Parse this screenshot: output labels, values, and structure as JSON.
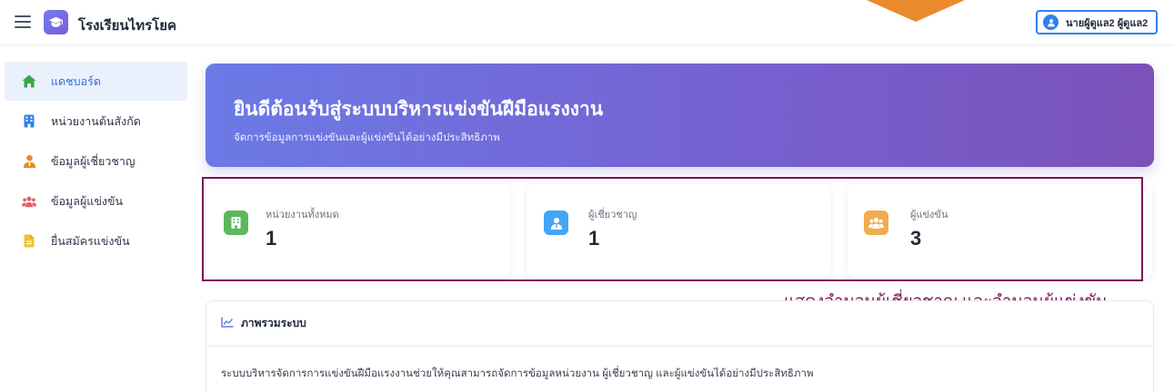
{
  "app": {
    "brand_name": "โรงเรียนไทรโยค",
    "brand_icon": "graduation-cap-icon"
  },
  "user": {
    "name": "นายผู้ดูแล2 ผู้ดูแล2",
    "icon": "user-icon"
  },
  "sidebar": {
    "items": [
      {
        "label": "แดชบอร์ด",
        "icon": "home-icon",
        "active": true,
        "color": "#3aa64a"
      },
      {
        "label": "หน่วยงานต้นสังกัด",
        "icon": "building-icon",
        "active": false,
        "color": "#2f80ed"
      },
      {
        "label": "ข้อมูลผู้เชี่ยวชาญ",
        "icon": "user-tie-icon",
        "active": false,
        "color": "#e98a2c"
      },
      {
        "label": "ข้อมูลผู้แข่งขัน",
        "icon": "users-icon",
        "active": false,
        "color": "#e85d6c"
      },
      {
        "label": "ยื่นสมัครแข่งขัน",
        "icon": "file-icon",
        "active": false,
        "color": "#f2c22e"
      }
    ]
  },
  "hero": {
    "title": "ยินดีต้อนรับสู่ระบบบริหารแข่งขันฝีมือแรงงาน",
    "subtitle": "จัดการข้อมูลการแข่งขันและผู้แข่งขันได้อย่างมีประสิทธิภาพ"
  },
  "stats": [
    {
      "label": "หน่วยงานทั้งหมด",
      "value": "1",
      "icon": "building-icon",
      "color": "#5cb85c"
    },
    {
      "label": "ผู้เชี่ยวชาญ",
      "value": "1",
      "icon": "user-tie-icon",
      "color": "#42a5f5"
    },
    {
      "label": "ผู้แข่งขัน",
      "value": "3",
      "icon": "users-icon",
      "color": "#f0ad4e"
    }
  ],
  "annotation": "แสดงจำนวนผู้เชี่ยวชาญ และจำนวนผู้แข่งขัน",
  "overview": {
    "title": "ภาพรวมระบบ",
    "icon": "chart-line-icon",
    "body": "ระบบบริหารจัดการการแข่งขันฝีมือแรงงานช่วยให้คุณสามารถจัดการข้อมูลหน่วยงาน ผู้เชี่ยวชาญ และผู้แข่งขันได้อย่างมีประสิทธิภาพ"
  }
}
